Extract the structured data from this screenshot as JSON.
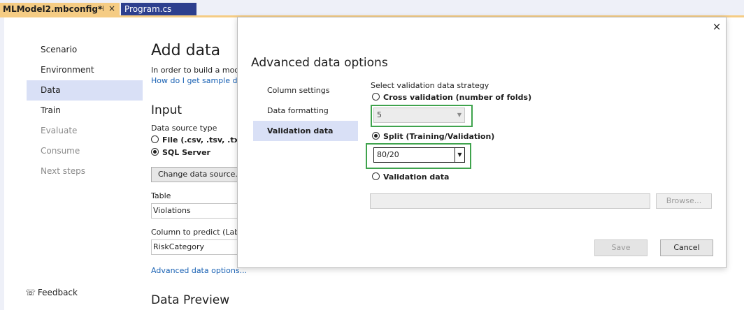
{
  "tabs": [
    {
      "title": "MLModel2.mbconfig*",
      "pin_icon": "pin-icon",
      "close_glyph": "×"
    },
    {
      "title": "Program.cs"
    }
  ],
  "sidebar": {
    "items": [
      {
        "label": "Scenario",
        "state": "normal"
      },
      {
        "label": "Environment",
        "state": "normal"
      },
      {
        "label": "Data",
        "state": "selected"
      },
      {
        "label": "Train",
        "state": "normal"
      },
      {
        "label": "Evaluate",
        "state": "disabled"
      },
      {
        "label": "Consume",
        "state": "disabled"
      },
      {
        "label": "Next steps",
        "state": "disabled"
      }
    ],
    "feedback_label": "Feedback"
  },
  "main": {
    "title": "Add data",
    "intro": "In order to build a mod",
    "how_link": "How do I get sample da",
    "input_heading": "Input",
    "source_type_label": "Data source type",
    "source_options": [
      {
        "label": "File (.csv, .tsv, .txt)",
        "checked": false
      },
      {
        "label": "SQL Server",
        "checked": true
      }
    ],
    "change_button": "Change data source...",
    "table_label": "Table",
    "table_value": "Violations",
    "column_label": "Column to predict (Lab",
    "column_value": "RiskCategory",
    "advanced_link": "Advanced data options...",
    "preview_heading": "Data Preview"
  },
  "dialog": {
    "close_glyph": "×",
    "title": "Advanced data options",
    "nav": [
      {
        "label": "Column settings",
        "selected": false
      },
      {
        "label": "Data formatting",
        "selected": false
      },
      {
        "label": "Validation data",
        "selected": true
      }
    ],
    "strategy_label": "Select validation data strategy",
    "cross_validation_label": "Cross validation (number of folds)",
    "folds_value": "5",
    "split_label": "Split (Training/Validation)",
    "split_value": "80/20",
    "validation_data_label": "Validation data",
    "browse_button": "Browse...",
    "save_button": "Save",
    "cancel_button": "Cancel"
  },
  "colors": {
    "active_tab": "#f5cc84",
    "inactive_tab": "#2d3f8e",
    "selection": "#d9e0f6",
    "link": "#1a62b4",
    "highlight_box": "#3fa34d"
  }
}
